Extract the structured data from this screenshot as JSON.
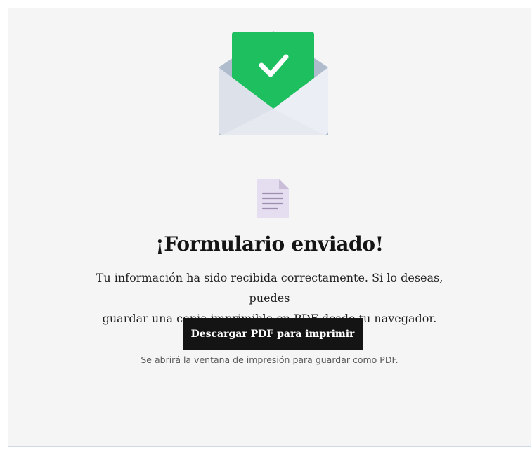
{
  "confirmation": {
    "title": "¡Formulario enviado!",
    "message_line1": "Tu información ha sido recibida correctamente. Si lo deseas, puedes",
    "message_line2": "guardar una copia imprimible en PDF desde tu navegador.",
    "download_button_label": "Descargar PDF para imprimir",
    "hint": "Se abrirá la ventana de impresión para guardar como PDF."
  },
  "icons": {
    "hero": "envelope-check-icon",
    "document": "document-icon"
  },
  "colors": {
    "accent_green": "#1dbf5e",
    "button_bg": "#141414",
    "button_text": "#ffffff",
    "card_bg": "#f5f5f5",
    "envelope_body": "#e6e9f0",
    "envelope_flap": "#aebcce",
    "document_bg": "#e5ddf0"
  }
}
